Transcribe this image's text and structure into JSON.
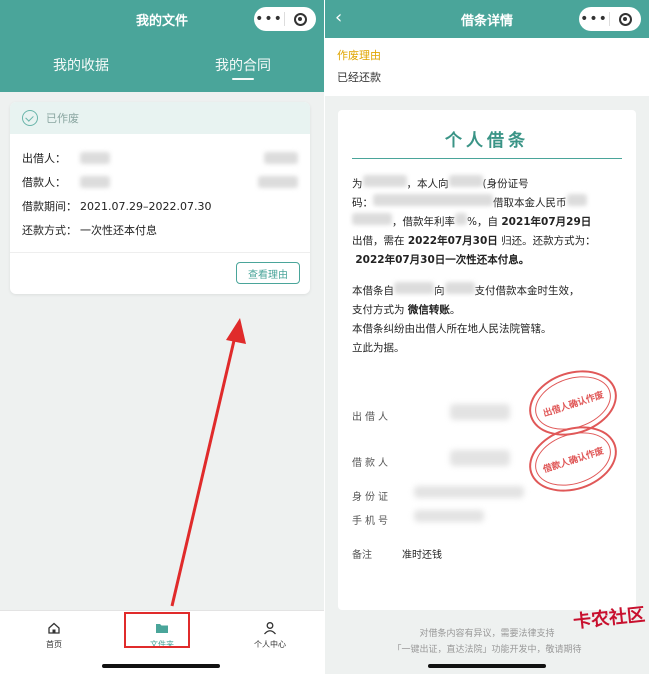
{
  "left": {
    "nav_title": "我的文件",
    "tabs": [
      {
        "label": "我的收据",
        "active": false
      },
      {
        "label": "我的合同",
        "active": true
      }
    ],
    "card": {
      "status": "已作废",
      "rows": [
        {
          "label": "出借人：",
          "value": ""
        },
        {
          "label": "借款人：",
          "value": ""
        },
        {
          "label": "借款期间：",
          "value": "2021.07.29–2022.07.30"
        },
        {
          "label": "还款方式：",
          "value": "一次性还本付息"
        }
      ],
      "button": "查看理由"
    },
    "bottom_nav": [
      {
        "label": "首页",
        "icon": "home-icon",
        "active": false
      },
      {
        "label": "文件夹",
        "icon": "folder-icon",
        "active": true
      },
      {
        "label": "个人中心",
        "icon": "user-icon",
        "active": false
      }
    ]
  },
  "right": {
    "nav_title": "借条详情",
    "reason_label": "作废理由",
    "reason_value": "已经还款",
    "doc": {
      "title": "个人借条",
      "p1_a": "为",
      "p1_b": "，本人向",
      "p1_c": "(身份证号",
      "p1_d": "码：",
      "p1_e": "借取本金人民币",
      "p1_f": "，借款年利率",
      "p1_g": "%，自",
      "p1_h": "2021年07月29日",
      "p1_i": "出借，需在",
      "p1_j": "2022年07月30日",
      "p1_k": "归还。还款方式为：",
      "p1_l": "2022年07月30日一次性还本付息。",
      "p2_a": "本借条自",
      "p2_b": "向",
      "p2_c": "支付借款本金时生效，",
      "p2_d": "支付方式为",
      "p2_e": "微信转账",
      "p2_f": "。",
      "p2_g": "本借条纠纷由出借人所在地人民法院管辖。",
      "p2_h": "立此为据。",
      "lender_label": "出借人",
      "borrower_label": "借款人",
      "id_label": "身份证",
      "phone_label": "手机号",
      "stamp1": "出借人确认作废",
      "stamp2": "借款人确认作废",
      "note_label": "备注",
      "note_value": "准时还钱"
    },
    "footer_line1": "对借条内容有异议，需要法律支持",
    "footer_line2": "「一键出证，直达法院」功能开发中，敬请期待",
    "watermark": "卡农社区"
  },
  "colors": {
    "teal": "#4aa59a",
    "stamp_red": "#e05858",
    "highlight": "#e02b2b"
  }
}
